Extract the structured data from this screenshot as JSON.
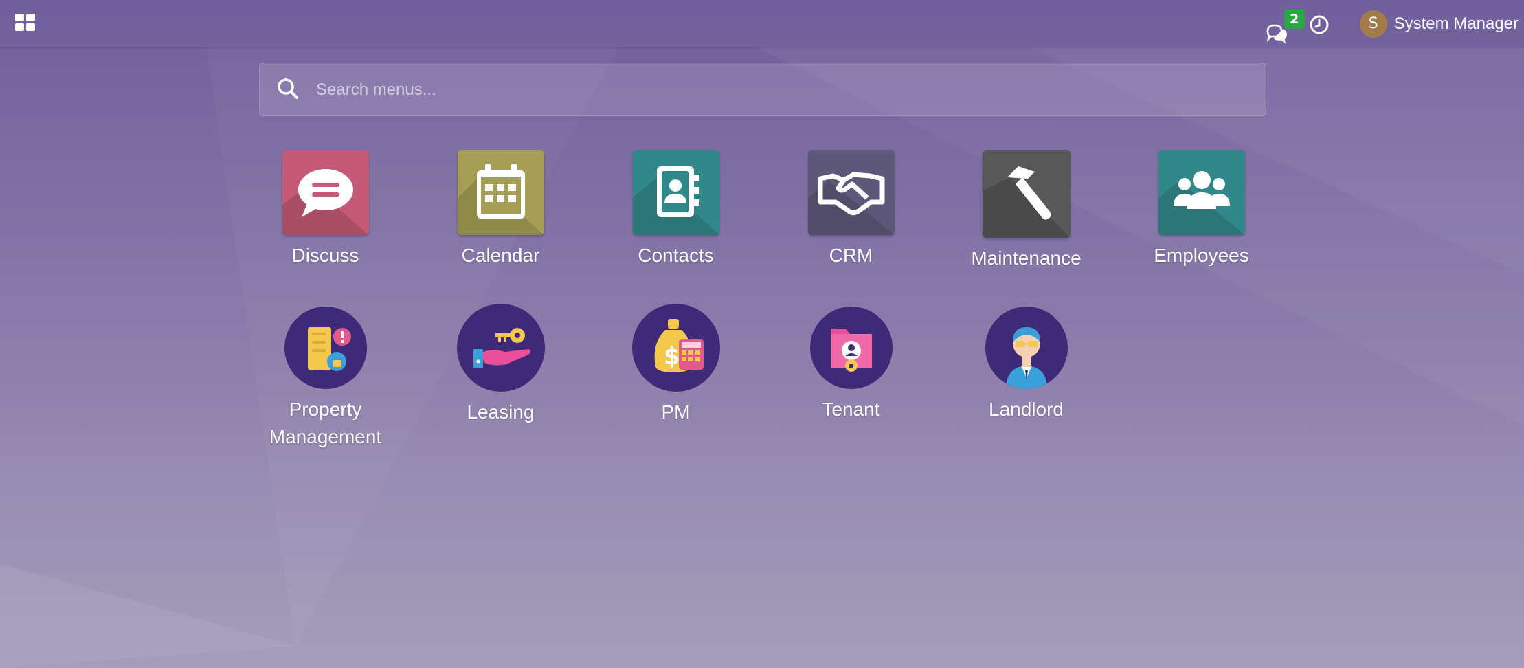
{
  "header": {
    "chat_badge_count": "2",
    "user_initial": "S",
    "user_name": "System Manager"
  },
  "search": {
    "placeholder": "Search menus..."
  },
  "apps": [
    {
      "label": "Discuss",
      "icon": "chat-bubble-icon",
      "color": "#c45a78"
    },
    {
      "label": "Calendar",
      "icon": "calendar-icon",
      "color": "#a59e55"
    },
    {
      "label": "Contacts",
      "icon": "address-book-icon",
      "color": "#31888a"
    },
    {
      "label": "CRM",
      "icon": "handshake-icon",
      "color": "#5e5878"
    },
    {
      "label": "Maintenance",
      "icon": "hammer-icon",
      "color": "#585858"
    },
    {
      "label": "Employees",
      "icon": "people-icon",
      "color": "#31888a"
    },
    {
      "label": "Property Management",
      "icon": "property-management-icon",
      "color": "#3e2a77"
    },
    {
      "label": "Leasing",
      "icon": "key-hand-icon",
      "color": "#3e2a77"
    },
    {
      "label": "PM",
      "icon": "money-bag-calculator-icon",
      "color": "#3e2a77"
    },
    {
      "label": "Tenant",
      "icon": "tenant-folder-icon",
      "color": "#3e2a77"
    },
    {
      "label": "Landlord",
      "icon": "landlord-person-icon",
      "color": "#3e2a77"
    }
  ]
}
